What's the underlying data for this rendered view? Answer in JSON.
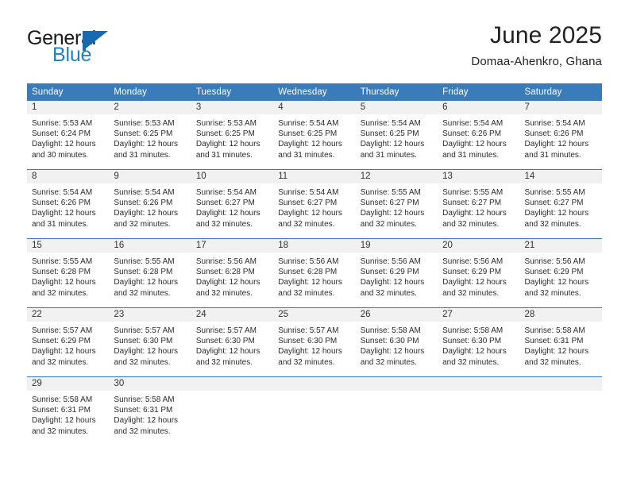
{
  "brand": {
    "word_top": "General",
    "word_bottom": "Blue",
    "mark": "triangle-logo",
    "colors": {
      "blue": "#1769b0",
      "text": "#1a1a1a",
      "blue_text": "#1f7fc4"
    }
  },
  "header": {
    "title": "June 2025",
    "subtitle": "Domaa-Ahenkro, Ghana"
  },
  "colors": {
    "header_blue": "#3a7cba",
    "daynum_band": "#f1f1f1",
    "text": "#2b2b2b"
  },
  "calendar": {
    "weekday_headers": [
      "Sunday",
      "Monday",
      "Tuesday",
      "Wednesday",
      "Thursday",
      "Friday",
      "Saturday"
    ],
    "weeks": [
      [
        {
          "day": "1",
          "sunrise": "Sunrise: 5:53 AM",
          "sunset": "Sunset: 6:24 PM",
          "daylight": "Daylight: 12 hours and 30 minutes."
        },
        {
          "day": "2",
          "sunrise": "Sunrise: 5:53 AM",
          "sunset": "Sunset: 6:25 PM",
          "daylight": "Daylight: 12 hours and 31 minutes."
        },
        {
          "day": "3",
          "sunrise": "Sunrise: 5:53 AM",
          "sunset": "Sunset: 6:25 PM",
          "daylight": "Daylight: 12 hours and 31 minutes."
        },
        {
          "day": "4",
          "sunrise": "Sunrise: 5:54 AM",
          "sunset": "Sunset: 6:25 PM",
          "daylight": "Daylight: 12 hours and 31 minutes."
        },
        {
          "day": "5",
          "sunrise": "Sunrise: 5:54 AM",
          "sunset": "Sunset: 6:25 PM",
          "daylight": "Daylight: 12 hours and 31 minutes."
        },
        {
          "day": "6",
          "sunrise": "Sunrise: 5:54 AM",
          "sunset": "Sunset: 6:26 PM",
          "daylight": "Daylight: 12 hours and 31 minutes."
        },
        {
          "day": "7",
          "sunrise": "Sunrise: 5:54 AM",
          "sunset": "Sunset: 6:26 PM",
          "daylight": "Daylight: 12 hours and 31 minutes."
        }
      ],
      [
        {
          "day": "8",
          "sunrise": "Sunrise: 5:54 AM",
          "sunset": "Sunset: 6:26 PM",
          "daylight": "Daylight: 12 hours and 31 minutes."
        },
        {
          "day": "9",
          "sunrise": "Sunrise: 5:54 AM",
          "sunset": "Sunset: 6:26 PM",
          "daylight": "Daylight: 12 hours and 32 minutes."
        },
        {
          "day": "10",
          "sunrise": "Sunrise: 5:54 AM",
          "sunset": "Sunset: 6:27 PM",
          "daylight": "Daylight: 12 hours and 32 minutes."
        },
        {
          "day": "11",
          "sunrise": "Sunrise: 5:54 AM",
          "sunset": "Sunset: 6:27 PM",
          "daylight": "Daylight: 12 hours and 32 minutes."
        },
        {
          "day": "12",
          "sunrise": "Sunrise: 5:55 AM",
          "sunset": "Sunset: 6:27 PM",
          "daylight": "Daylight: 12 hours and 32 minutes."
        },
        {
          "day": "13",
          "sunrise": "Sunrise: 5:55 AM",
          "sunset": "Sunset: 6:27 PM",
          "daylight": "Daylight: 12 hours and 32 minutes."
        },
        {
          "day": "14",
          "sunrise": "Sunrise: 5:55 AM",
          "sunset": "Sunset: 6:27 PM",
          "daylight": "Daylight: 12 hours and 32 minutes."
        }
      ],
      [
        {
          "day": "15",
          "sunrise": "Sunrise: 5:55 AM",
          "sunset": "Sunset: 6:28 PM",
          "daylight": "Daylight: 12 hours and 32 minutes."
        },
        {
          "day": "16",
          "sunrise": "Sunrise: 5:55 AM",
          "sunset": "Sunset: 6:28 PM",
          "daylight": "Daylight: 12 hours and 32 minutes."
        },
        {
          "day": "17",
          "sunrise": "Sunrise: 5:56 AM",
          "sunset": "Sunset: 6:28 PM",
          "daylight": "Daylight: 12 hours and 32 minutes."
        },
        {
          "day": "18",
          "sunrise": "Sunrise: 5:56 AM",
          "sunset": "Sunset: 6:28 PM",
          "daylight": "Daylight: 12 hours and 32 minutes."
        },
        {
          "day": "19",
          "sunrise": "Sunrise: 5:56 AM",
          "sunset": "Sunset: 6:29 PM",
          "daylight": "Daylight: 12 hours and 32 minutes."
        },
        {
          "day": "20",
          "sunrise": "Sunrise: 5:56 AM",
          "sunset": "Sunset: 6:29 PM",
          "daylight": "Daylight: 12 hours and 32 minutes."
        },
        {
          "day": "21",
          "sunrise": "Sunrise: 5:56 AM",
          "sunset": "Sunset: 6:29 PM",
          "daylight": "Daylight: 12 hours and 32 minutes."
        }
      ],
      [
        {
          "day": "22",
          "sunrise": "Sunrise: 5:57 AM",
          "sunset": "Sunset: 6:29 PM",
          "daylight": "Daylight: 12 hours and 32 minutes."
        },
        {
          "day": "23",
          "sunrise": "Sunrise: 5:57 AM",
          "sunset": "Sunset: 6:30 PM",
          "daylight": "Daylight: 12 hours and 32 minutes."
        },
        {
          "day": "24",
          "sunrise": "Sunrise: 5:57 AM",
          "sunset": "Sunset: 6:30 PM",
          "daylight": "Daylight: 12 hours and 32 minutes."
        },
        {
          "day": "25",
          "sunrise": "Sunrise: 5:57 AM",
          "sunset": "Sunset: 6:30 PM",
          "daylight": "Daylight: 12 hours and 32 minutes."
        },
        {
          "day": "26",
          "sunrise": "Sunrise: 5:58 AM",
          "sunset": "Sunset: 6:30 PM",
          "daylight": "Daylight: 12 hours and 32 minutes."
        },
        {
          "day": "27",
          "sunrise": "Sunrise: 5:58 AM",
          "sunset": "Sunset: 6:30 PM",
          "daylight": "Daylight: 12 hours and 32 minutes."
        },
        {
          "day": "28",
          "sunrise": "Sunrise: 5:58 AM",
          "sunset": "Sunset: 6:31 PM",
          "daylight": "Daylight: 12 hours and 32 minutes."
        }
      ],
      [
        {
          "day": "29",
          "sunrise": "Sunrise: 5:58 AM",
          "sunset": "Sunset: 6:31 PM",
          "daylight": "Daylight: 12 hours and 32 minutes."
        },
        {
          "day": "30",
          "sunrise": "Sunrise: 5:58 AM",
          "sunset": "Sunset: 6:31 PM",
          "daylight": "Daylight: 12 hours and 32 minutes."
        },
        {
          "day": "",
          "sunrise": "",
          "sunset": "",
          "daylight": ""
        },
        {
          "day": "",
          "sunrise": "",
          "sunset": "",
          "daylight": ""
        },
        {
          "day": "",
          "sunrise": "",
          "sunset": "",
          "daylight": ""
        },
        {
          "day": "",
          "sunrise": "",
          "sunset": "",
          "daylight": ""
        },
        {
          "day": "",
          "sunrise": "",
          "sunset": "",
          "daylight": ""
        }
      ]
    ]
  }
}
